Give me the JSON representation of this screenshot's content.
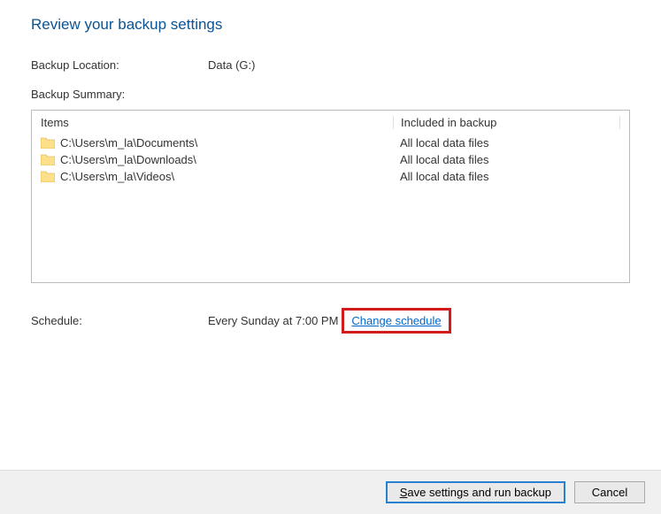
{
  "title": "Review your backup settings",
  "location": {
    "label": "Backup Location:",
    "value": "Data (G:)"
  },
  "summary": {
    "label": "Backup Summary:",
    "headers": {
      "items": "Items",
      "included": "Included in backup"
    },
    "rows": [
      {
        "path": "C:\\Users\\m_la\\Documents\\",
        "included": "All local data files"
      },
      {
        "path": "C:\\Users\\m_la\\Downloads\\",
        "included": "All local data files"
      },
      {
        "path": "C:\\Users\\m_la\\Videos\\",
        "included": "All local data files"
      }
    ]
  },
  "schedule": {
    "label": "Schedule:",
    "value": "Every Sunday at 7:00 PM",
    "link": "Change schedule"
  },
  "buttons": {
    "save": "Save settings and run backup",
    "cancel": "Cancel"
  }
}
